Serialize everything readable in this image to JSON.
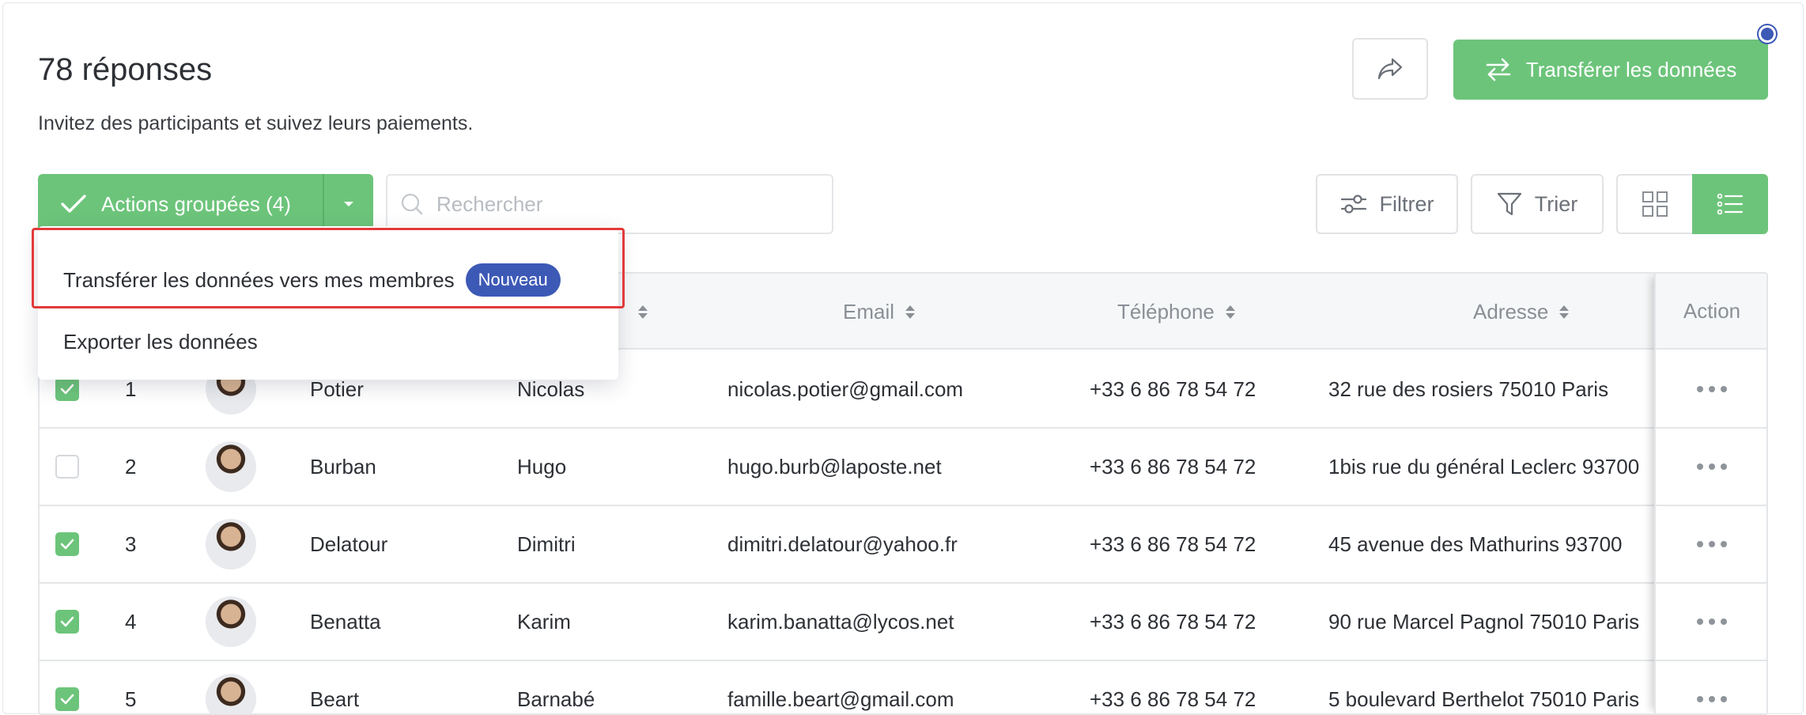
{
  "header": {
    "title": "78 réponses",
    "subtitle": "Invitez des participants et suivez leurs paiements.",
    "transfer_label": "Transférer les données"
  },
  "toolbar": {
    "bulk_label": "Actions groupées (4)",
    "search_placeholder": "Rechercher",
    "filter_label": "Filtrer",
    "sort_label": "Trier"
  },
  "dropdown": {
    "items": [
      {
        "label": "Transférer les données vers mes membres",
        "badge": "Nouveau"
      },
      {
        "label": "Exporter les données"
      }
    ]
  },
  "table": {
    "columns": {
      "email": "Email",
      "phone": "Téléphone",
      "address": "Adresse",
      "action": "Action"
    },
    "rows": [
      {
        "checked": true,
        "num": "1",
        "last": "Potier",
        "first": "Nicolas",
        "email": "nicolas.potier@gmail.com",
        "phone": "+33 6 86 78 54 72",
        "address": "32 rue des rosiers 75010 Paris"
      },
      {
        "checked": false,
        "num": "2",
        "last": "Burban",
        "first": "Hugo",
        "email": "hugo.burb@laposte.net",
        "phone": "+33 6 86 78 54 72",
        "address": "1bis rue du général Leclerc 93700"
      },
      {
        "checked": true,
        "num": "3",
        "last": "Delatour",
        "first": "Dimitri",
        "email": "dimitri.delatour@yahoo.fr",
        "phone": "+33 6 86 78 54 72",
        "address": "45 avenue des Mathurins 93700"
      },
      {
        "checked": true,
        "num": "4",
        "last": "Benatta",
        "first": "Karim",
        "email": "karim.banatta@lycos.net",
        "phone": "+33 6 86 78 54 72",
        "address": "90 rue Marcel Pagnol 75010 Paris"
      },
      {
        "checked": true,
        "num": "5",
        "last": "Beart",
        "first": "Barnabé",
        "email": "famille.beart@gmail.com",
        "phone": "+33 6 86 78 54 72",
        "address": "5 boulevard Berthelot 75010 Paris"
      }
    ]
  },
  "colors": {
    "accent": "#6cc47a",
    "badge": "#3d59b6",
    "highlight": "#e23a3a"
  }
}
